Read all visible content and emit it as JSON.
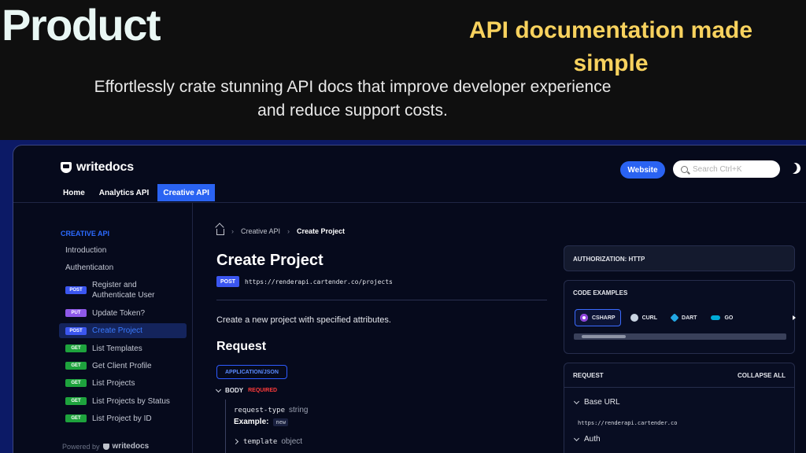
{
  "promo": {
    "title": "Product",
    "tagline": "API documentation made simple",
    "description": "Effortlessly crate stunning API docs that improve developer experience and reduce support costs."
  },
  "app": {
    "logo_text": "writedocs",
    "website_button": "Website",
    "search_placeholder": "Search Ctrl+K",
    "tabs": [
      {
        "label": "Home",
        "active": false
      },
      {
        "label": "Analytics API",
        "active": false
      },
      {
        "label": "Creative API",
        "active": true
      }
    ]
  },
  "sidebar": {
    "section": "CREATIVE API",
    "items": [
      {
        "method": "",
        "label": "Introduction"
      },
      {
        "method": "",
        "label": "Authenticaton"
      },
      {
        "method": "POST",
        "label": "Register and Authenticate User"
      },
      {
        "method": "PUT",
        "label": "Update Token?"
      },
      {
        "method": "POST",
        "label": "Create Project",
        "active": true
      },
      {
        "method": "GET",
        "label": "List Templates"
      },
      {
        "method": "GET",
        "label": "Get Client Profile"
      },
      {
        "method": "GET",
        "label": "List Projects"
      },
      {
        "method": "GET",
        "label": "List Projects by Status"
      },
      {
        "method": "GET",
        "label": "List Project by ID"
      }
    ],
    "powered_by": "Powered by",
    "powered_brand": "writedocs"
  },
  "main": {
    "breadcrumb": [
      "Creative API",
      "Create Project"
    ],
    "title": "Create Project",
    "method": "POST",
    "url": "https://renderapi.cartender.co/projects",
    "description": "Create a new project with specified attributes.",
    "request_title": "Request",
    "content_type": "APPLICATION/JSON",
    "body_label": "BODY",
    "required_label": "REQUIRED",
    "field1_name": "request-type",
    "field1_type": "string",
    "example_label": "Example:",
    "example_value": "new",
    "field2_name": "template",
    "field2_type": "object"
  },
  "right_panel": {
    "authorization": "AUTHORIZATION: HTTP",
    "code_examples": "CODE EXAMPLES",
    "languages": [
      {
        "label": "CSHARP",
        "icon": "csharp-icon",
        "active": true
      },
      {
        "label": "CURL",
        "icon": "curl-icon",
        "active": false
      },
      {
        "label": "DART",
        "icon": "dart-icon",
        "active": false
      },
      {
        "label": "GO",
        "icon": "go-icon",
        "active": false
      }
    ],
    "request_label": "REQUEST",
    "collapse_all": "COLLAPSE ALL",
    "base_url_label": "Base URL",
    "base_url": "https://renderapi.cartender.co",
    "auth_label": "Auth"
  },
  "colors": {
    "accent": "#2a63f2",
    "tagline": "#f8d25e",
    "post": "#3b56f0",
    "put": "#8e58e8",
    "get": "#1ea33d",
    "required": "#ff3b3b"
  }
}
